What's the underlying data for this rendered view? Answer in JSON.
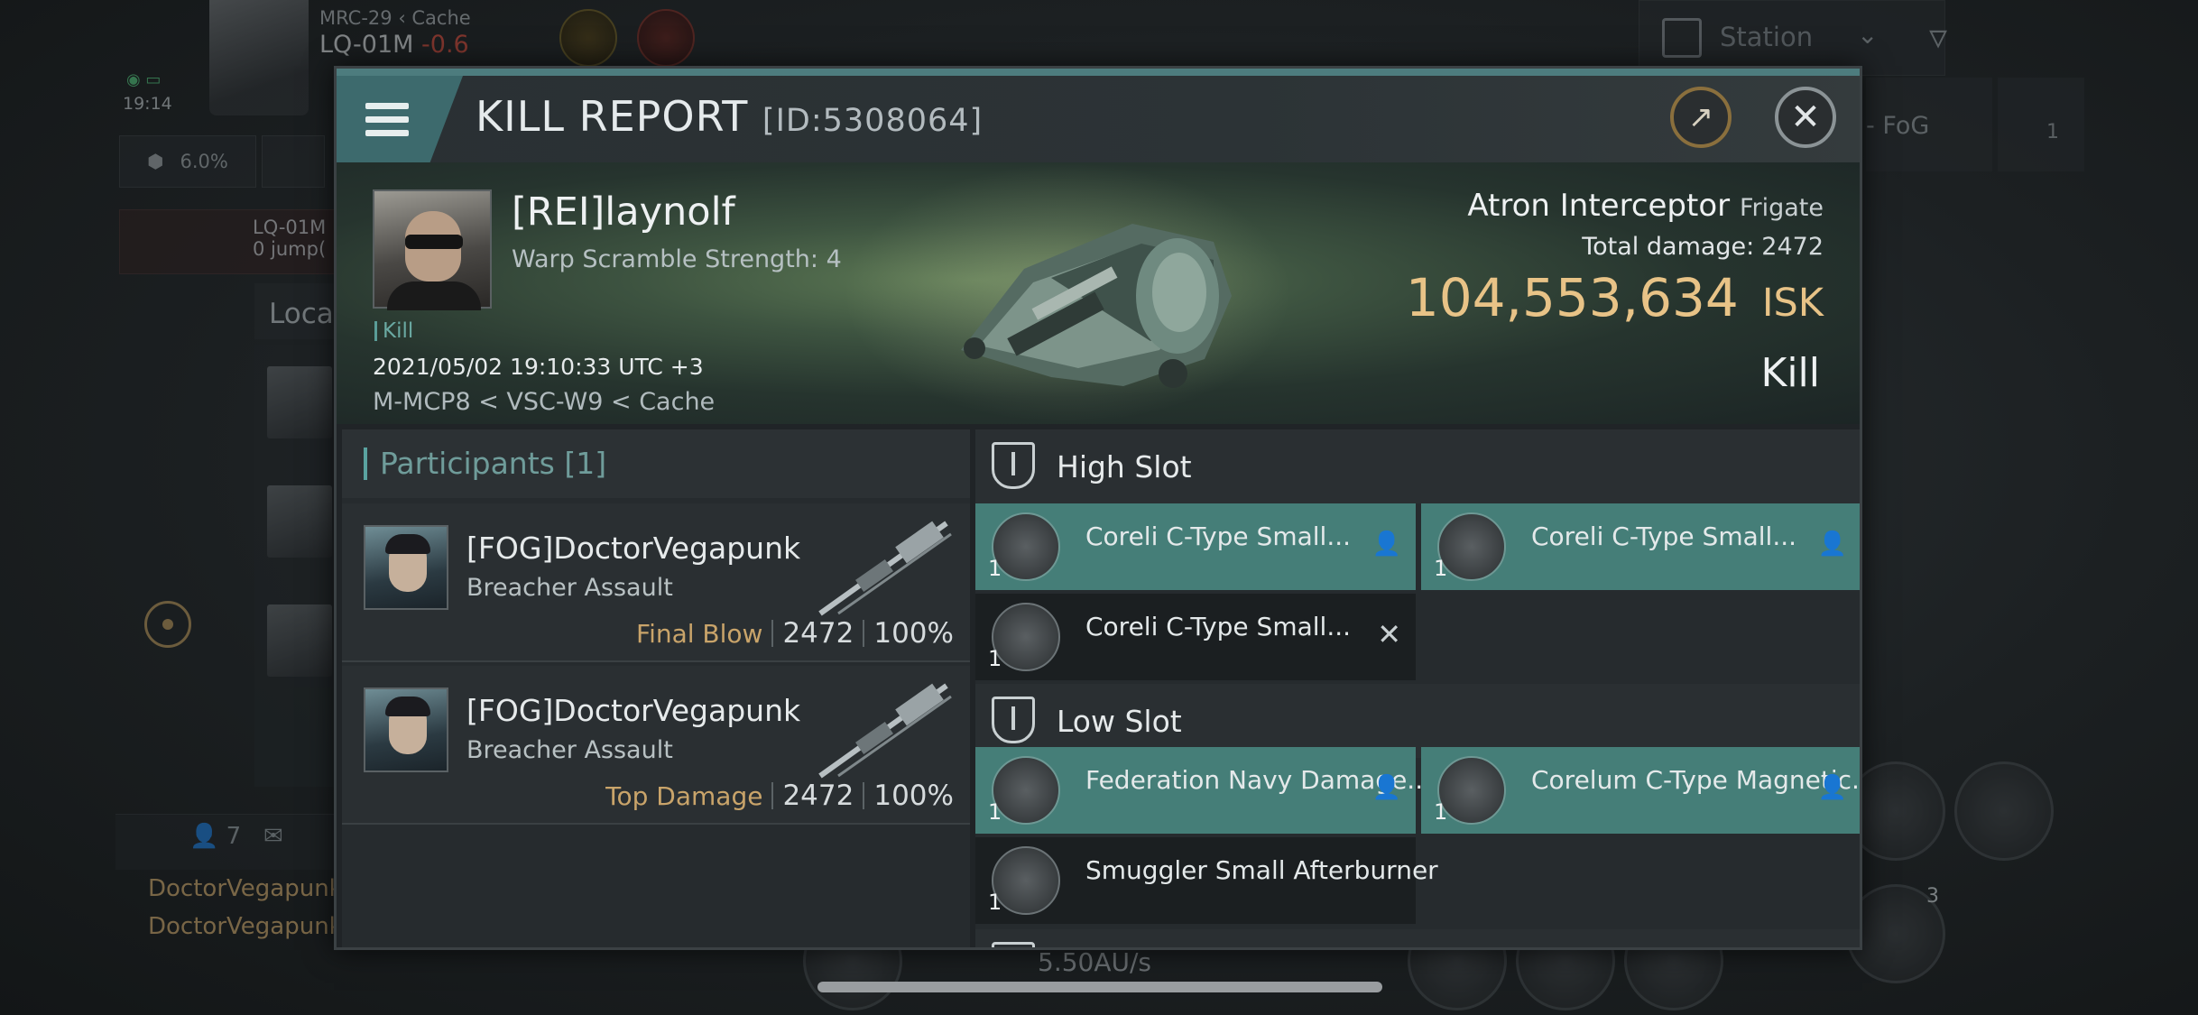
{
  "hud": {
    "system_sub": "MRC-29",
    "system_region": "Cache",
    "system_name": "LQ-01M",
    "system_security": "-0.6",
    "time": "19:14",
    "stat_percent": "6.0%",
    "route_text_1": "LQ-01M",
    "route_text_2": "0 jump(",
    "local_label": "Loca",
    "chat_members": "7",
    "chat_lines": [
      "DoctorVegapunk",
      "DoctorVegapunk"
    ],
    "station_filter": "Station",
    "fleet_label": "- FoG",
    "fleet_count": "1",
    "speed": "5.50AU/s",
    "module_badge": "3"
  },
  "modal": {
    "title": "KILL REPORT",
    "id": "[ID:5308064]"
  },
  "victim": {
    "name": "[REI]laynolf",
    "warp_scramble": "Warp Scramble Strength: 4",
    "tag": "Kill",
    "date": "2021/05/02 19:10:33 UTC +3",
    "location": "M-MCP8 < VSC-W9 < Cache",
    "ship_name": "Atron Interceptor",
    "ship_class": "Frigate",
    "total_damage_label": "Total damage:",
    "total_damage": "2472",
    "isk_value": "104,553,634",
    "isk_unit": "ISK",
    "result": "Kill"
  },
  "participants": {
    "title": "Participants",
    "count": "[1]",
    "rows": [
      {
        "name": "[FOG]DoctorVegapunk",
        "ship": "Breacher Assault",
        "role": "Final Blow",
        "damage": "2472",
        "percent": "100%"
      },
      {
        "name": "[FOG]DoctorVegapunk",
        "ship": "Breacher Assault",
        "role": "Top Damage",
        "damage": "2472",
        "percent": "100%"
      }
    ]
  },
  "fitting": {
    "high_slot": {
      "title": "High Slot",
      "modules": [
        {
          "name": "Coreli C-Type Small...",
          "qty": "1",
          "state": "destroyed"
        },
        {
          "name": "Coreli C-Type Small...",
          "qty": "1",
          "state": "destroyed"
        },
        {
          "name": "Coreli C-Type Small...",
          "qty": "1",
          "state": "dropped"
        }
      ]
    },
    "low_slot": {
      "title": "Low Slot",
      "modules": [
        {
          "name": "Federation Navy Damage...",
          "qty": "1",
          "state": "destroyed"
        },
        {
          "name": "Corelum C-Type Magnetic...",
          "qty": "1",
          "state": "destroyed"
        },
        {
          "name": "Smuggler Small Afterburner",
          "qty": "1",
          "state": "dropped"
        }
      ]
    },
    "icons": {
      "destroyed": "person-icon",
      "dropped": "x-icon"
    }
  },
  "colors": {
    "accent_teal": "#457e78",
    "isk_gold": "#e8c387",
    "role_gold": "#c9a46a",
    "security_red": "#d24a3a"
  }
}
